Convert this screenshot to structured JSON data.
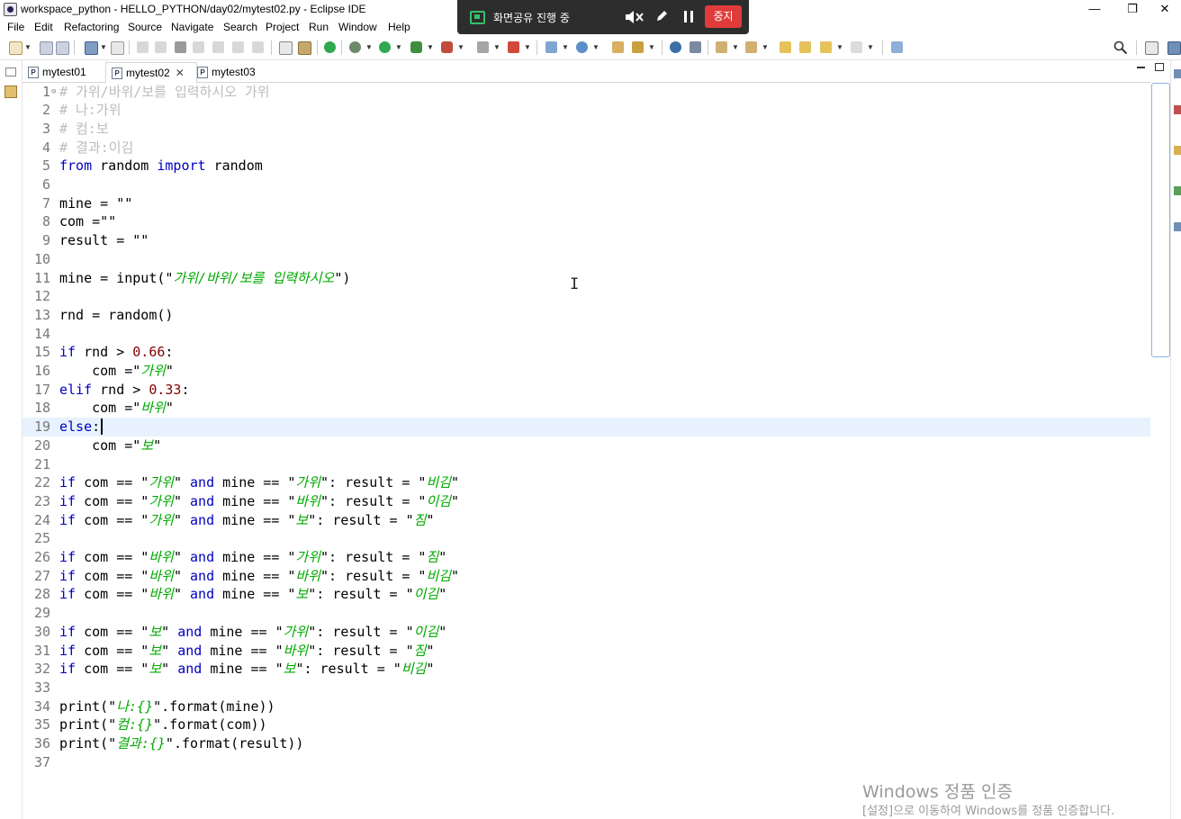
{
  "window": {
    "title": "workspace_python - HELLO_PYTHON/day02/mytest02.py - Eclipse IDE",
    "minimize": "—",
    "maximize": "❐",
    "close": "✕"
  },
  "menu": [
    "File",
    "Edit",
    "Refactoring",
    "Source",
    "Navigate",
    "Search",
    "Project",
    "Run",
    "Window",
    "Help"
  ],
  "screen_share": {
    "status": "화면공유 진행 중",
    "stop_label": "중지"
  },
  "tabs": [
    {
      "label": "mytest01",
      "active": false
    },
    {
      "label": "mytest02",
      "active": true
    },
    {
      "label": "mytest03",
      "active": false
    }
  ],
  "editor": {
    "current_line": 19,
    "lines": [
      "# 가위/바위/보를 입력하시오 가위",
      "# 나:가위",
      "# 컴:보",
      "# 결과:이김",
      "from random import random",
      "",
      "mine = \"\"",
      "com =\"\"",
      "result = \"\"",
      "",
      "mine = input(\"가위/바위/보를 입력하시오\")",
      "",
      "rnd = random()",
      "",
      "if rnd > 0.66:",
      "    com =\"가위\"",
      "elif rnd > 0.33:",
      "    com =\"바위\"",
      "else:",
      "    com =\"보\"",
      "",
      "if com == \"가위\" and mine == \"가위\": result = \"비김\"",
      "if com == \"가위\" and mine == \"바위\": result = \"이김\"",
      "if com == \"가위\" and mine == \"보\": result = \"짐\"",
      "",
      "if com == \"바위\" and mine == \"가위\": result = \"짐\"",
      "if com == \"바위\" and mine == \"바위\": result = \"비김\"",
      "if com == \"바위\" and mine == \"보\": result = \"이김\"",
      "",
      "if com == \"보\" and mine == \"가위\": result = \"이김\"",
      "if com == \"보\" and mine == \"바위\": result = \"짐\"",
      "if com == \"보\" and mine == \"보\": result = \"비김\"",
      "",
      "print(\"나:{}\".format(mine))",
      "print(\"컴:{}\".format(com))",
      "print(\"결과:{}\".format(result))",
      ""
    ]
  },
  "watermark": {
    "line1": "Windows 정품 인증",
    "line2": "[설정]으로 이동하여 Windows를 정품 인증합니다."
  },
  "colors": {
    "keyword": "#0000c0",
    "string": "#00aa00",
    "number": "#800000",
    "comment": "#bcbcbc",
    "current_line": "#e8f2fe",
    "stop_button": "#e03b3b"
  }
}
